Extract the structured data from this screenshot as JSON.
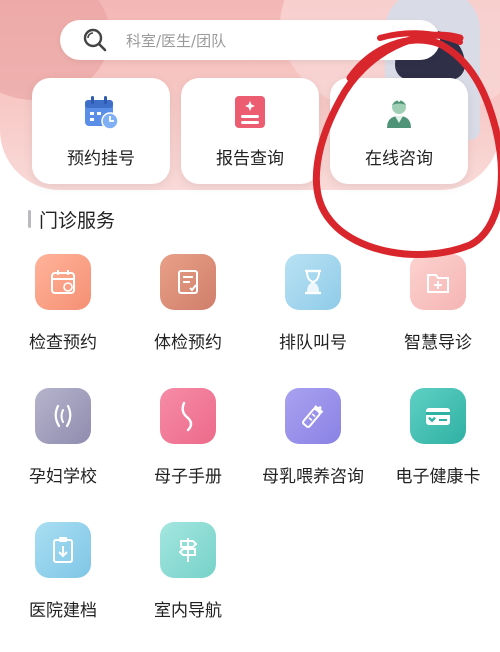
{
  "search": {
    "placeholder": "科室/医生/团队"
  },
  "quick_actions": [
    {
      "label": "预约挂号",
      "icon": "calendar-clock-icon"
    },
    {
      "label": "报告查询",
      "icon": "report-icon"
    },
    {
      "label": "在线咨询",
      "icon": "doctor-icon"
    }
  ],
  "section": {
    "title": "门诊服务"
  },
  "services": [
    {
      "label": "检查预约",
      "icon": "calendar-icon"
    },
    {
      "label": "体检预约",
      "icon": "checkup-form-icon"
    },
    {
      "label": "排队叫号",
      "icon": "hourglass-icon"
    },
    {
      "label": "智慧导诊",
      "icon": "medical-folder-icon"
    },
    {
      "label": "孕妇学校",
      "icon": "pregnancy-icon"
    },
    {
      "label": "母子手册",
      "icon": "maternal-booklet-icon"
    },
    {
      "label": "母乳喂养咨询",
      "icon": "baby-bottle-icon"
    },
    {
      "label": "电子健康卡",
      "icon": "health-card-icon"
    },
    {
      "label": "医院建档",
      "icon": "clipboard-icon"
    },
    {
      "label": "室内导航",
      "icon": "signpost-icon"
    }
  ],
  "colors": {
    "hero": "#f3b7b5",
    "annotation": "#d9252c"
  }
}
